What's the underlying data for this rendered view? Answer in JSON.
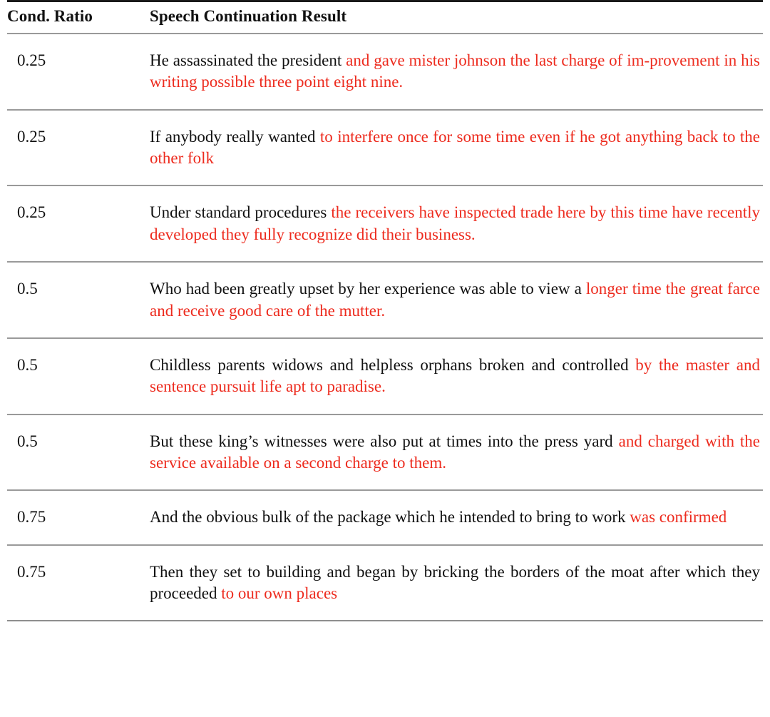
{
  "table": {
    "columns": [
      {
        "key": "cond_ratio",
        "label": "Cond. Ratio"
      },
      {
        "key": "continuation",
        "label": "Speech Continuation Result"
      }
    ],
    "accent_color_prompt": "#111111",
    "accent_color_continuation": "#ED2B1E",
    "rows": [
      {
        "cond_ratio": "0.25",
        "prompt": "He assassinated the president ",
        "continuation": "and gave mister johnson the last charge of im-provement in his writing possible three point eight nine."
      },
      {
        "cond_ratio": "0.25",
        "prompt": "If anybody really wanted ",
        "continuation": "to interfere once for some time even if he got anything back to the other folk"
      },
      {
        "cond_ratio": "0.25",
        "prompt": "Under standard procedures ",
        "continuation": "the receivers have inspected trade here by this time have recently developed they fully recognize did their business."
      },
      {
        "cond_ratio": "0.5",
        "prompt": "Who had been greatly upset by her experience was able to view a ",
        "continuation": "longer time the great farce and receive good care of the mutter."
      },
      {
        "cond_ratio": "0.5",
        "prompt": "Childless parents widows and helpless orphans broken and controlled ",
        "continuation": "by the master and sentence pursuit life apt to paradise."
      },
      {
        "cond_ratio": "0.5",
        "prompt": "But these king’s witnesses were also put at times into the press yard ",
        "continuation": "and charged with the service available on a second charge to them."
      },
      {
        "cond_ratio": "0.75",
        "prompt": "And the obvious bulk of the package which he intended to bring to work ",
        "continuation": "was confirmed"
      },
      {
        "cond_ratio": "0.75",
        "prompt": "Then they set to building and began by bricking the borders of the moat after which they proceeded ",
        "continuation": "to our own places"
      }
    ]
  }
}
